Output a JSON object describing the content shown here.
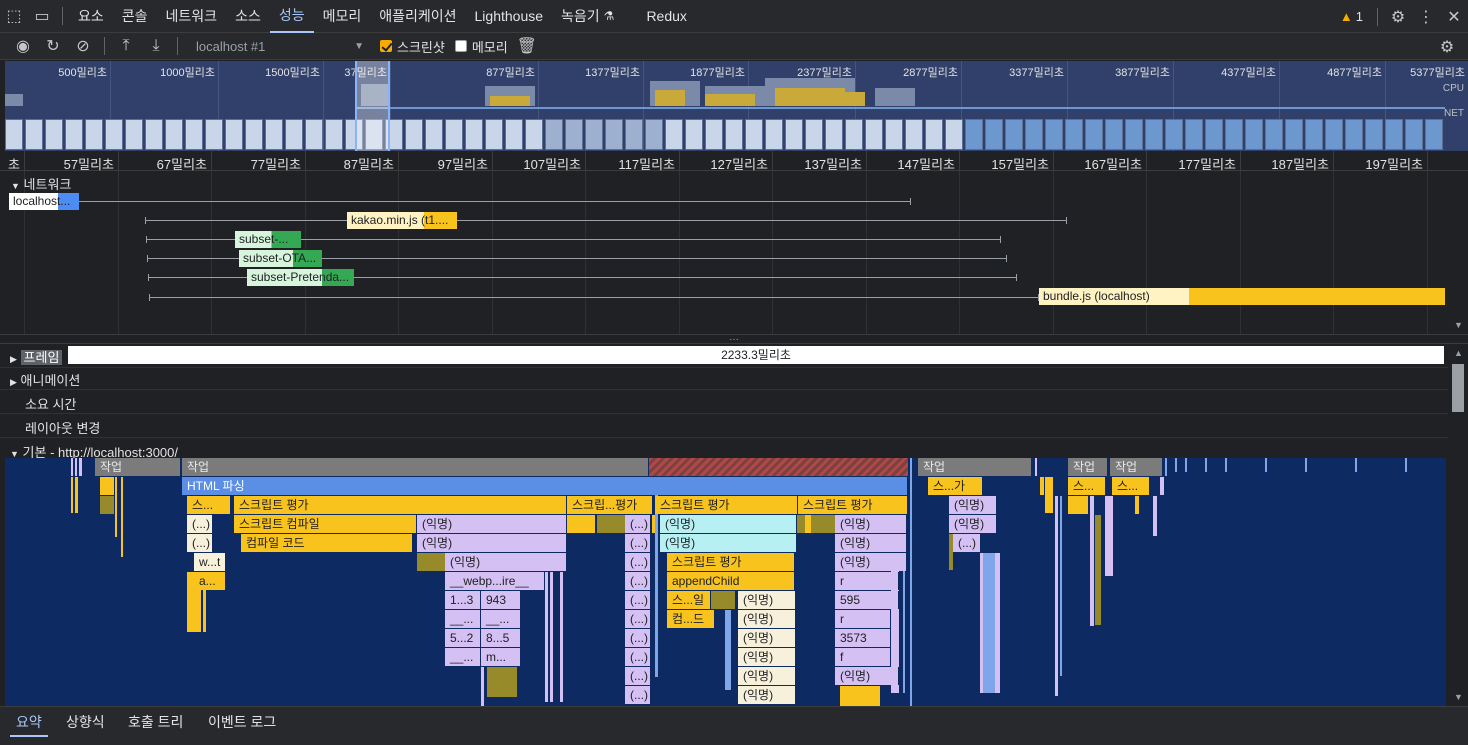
{
  "tabbar": {
    "tabs": [
      "요소",
      "콘솔",
      "네트워크",
      "소스",
      "성능",
      "메모리",
      "애플리케이션",
      "Lighthouse",
      "녹음기",
      "Redux"
    ],
    "active_tab": "성능",
    "issues_count": "1"
  },
  "toolbar": {
    "target": "localhost #1",
    "screenshots_label": "스크린샷",
    "screenshots_checked": true,
    "memory_label": "메모리",
    "memory_checked": false
  },
  "overview": {
    "labels": [
      "500밀리초",
      "1000밀리초",
      "1500밀리초",
      "37밀리초",
      "877밀리초",
      "1377밀리초",
      "1877밀리초",
      "2377밀리초",
      "2877밀리초",
      "3377밀리초",
      "3877밀리초",
      "4377밀리초",
      "4877밀리초",
      "5377밀리초"
    ],
    "cpu_label": "CPU",
    "net_label": "NET"
  },
  "ruler": {
    "labels": [
      "초",
      "57밀리초",
      "67밀리초",
      "77밀리초",
      "87밀리초",
      "97밀리초",
      "107밀리초",
      "117밀리초",
      "127밀리초",
      "137밀리초",
      "147밀리초",
      "157밀리초",
      "167밀리초",
      "177밀리초",
      "187밀리초",
      "197밀리초"
    ]
  },
  "network": {
    "title": "네트워크",
    "requests": [
      {
        "label": "localhost...",
        "color": "#4c8df5"
      },
      {
        "label": "kakao.min.js (t1....",
        "color": "#f8c31c"
      },
      {
        "label": "subset-...",
        "color": "#34a853"
      },
      {
        "label": "subset-OTA...",
        "color": "#34a853"
      },
      {
        "label": "subset-Pretenda...",
        "color": "#34a853"
      },
      {
        "label": "bundle.js (localhost)",
        "color": "#f8c31c"
      }
    ]
  },
  "tracks": {
    "frames_label": "프레임",
    "frames_value": "2233.3밀리초",
    "animations_label": "애니메이션",
    "timings_label": "소요 시간",
    "layout_shifts_label": "레이아웃 변경",
    "main_label": "기본 - http://localhost:3000/"
  },
  "flame": {
    "task": "작업",
    "html_parse": "HTML 파싱",
    "script_eval": "스크립트 평가",
    "script_eval_short": "스크립...평가",
    "script_compile": "스크립트 컴파일",
    "compile_code": "컴파일 코드",
    "anonymous": "(익명)",
    "ellipsis_fn": "(...)",
    "webpack": "__webp...ire__",
    "append_child": "appendChild",
    "script_add": "스...가",
    "s_ellipsis": "스...",
    "s_il": "스...일",
    "compile_d": "컴...드",
    "w_t": "w...t",
    "a_": "a...",
    "n1_3": "1...3",
    "n943": "943",
    "dash1": "__...",
    "dash2": "__...",
    "n5_2": "5...2",
    "n8_5": "8...5",
    "dash3": "__...",
    "m_": "m...",
    "r": "r",
    "n595": "595",
    "n3573": "3573",
    "f": "f"
  },
  "bottom_tabs": [
    "요약",
    "상향식",
    "호출 트리",
    "이벤트 로그"
  ]
}
